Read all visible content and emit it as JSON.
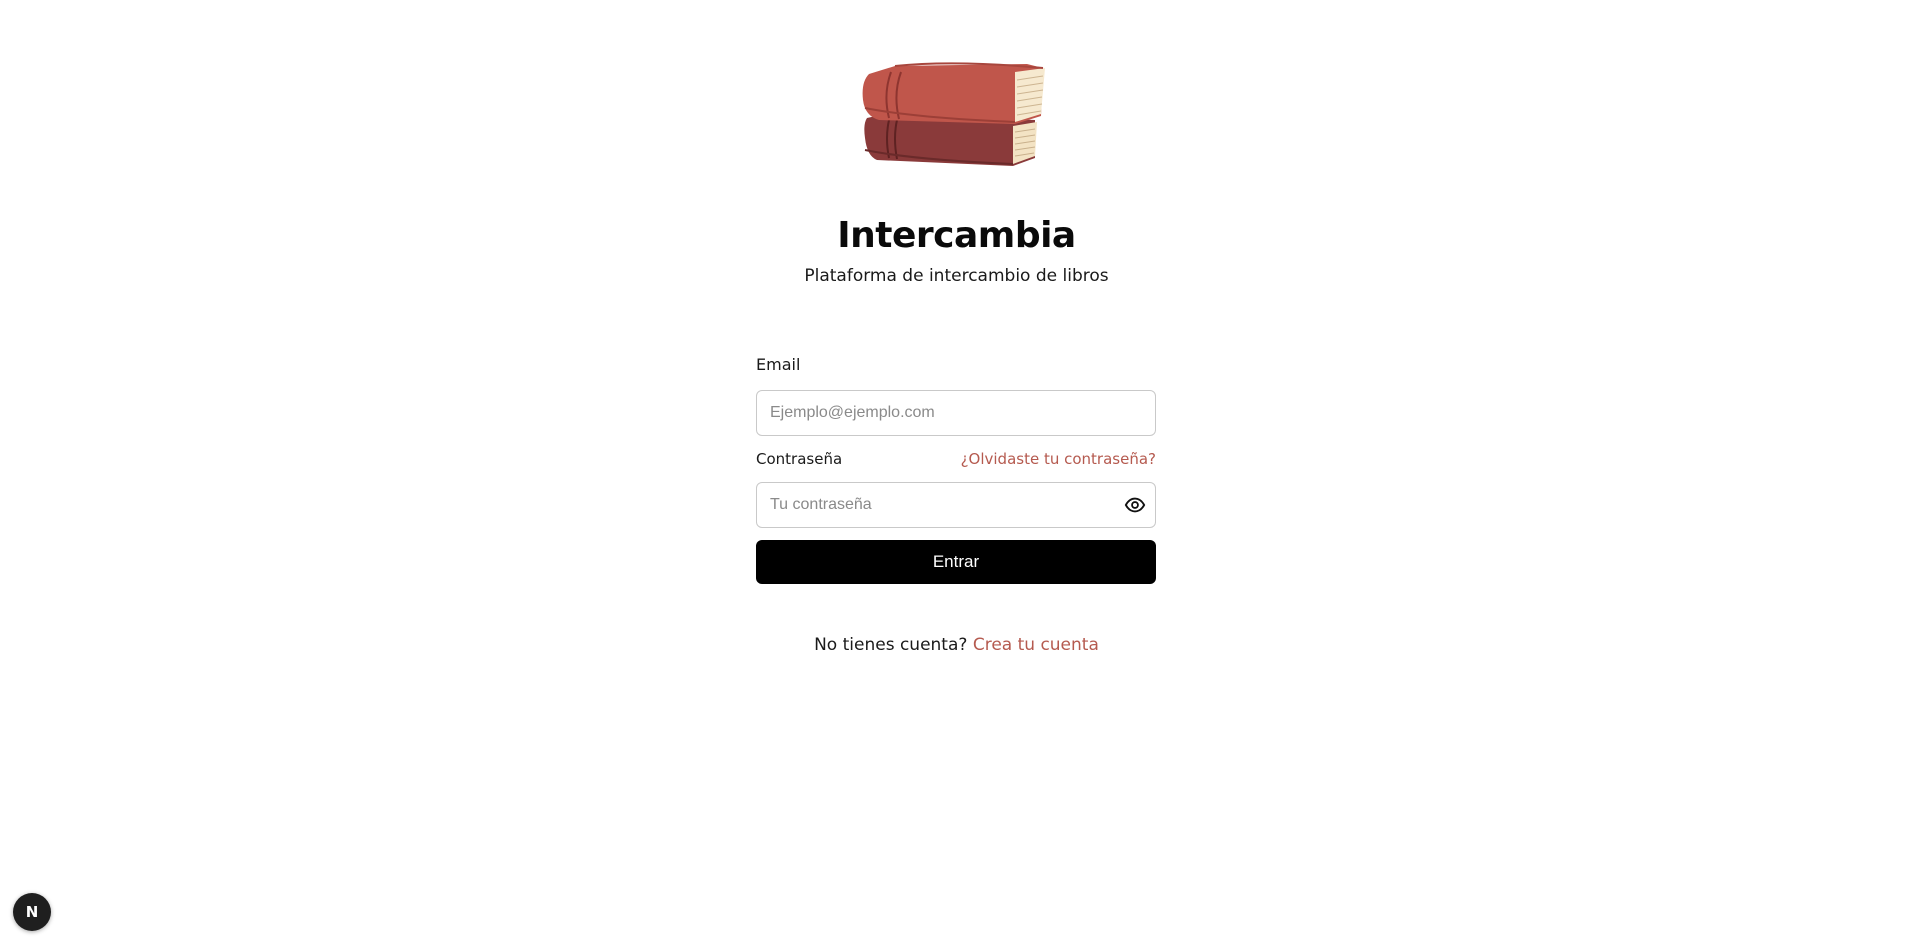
{
  "app": {
    "title": "Intercambia",
    "subtitle": "Plataforma de intercambio de libros",
    "logo_icon": "stacked-books-icon",
    "accent_color": "#b55a4f"
  },
  "form": {
    "email_label": "Email",
    "email_placeholder": "Ejemplo@ejemplo.com",
    "email_value": "",
    "password_label": "Contraseña",
    "forgot_password": "¿Olvidaste tu contraseña?",
    "password_placeholder": "Tu contraseña",
    "password_value": "",
    "password_toggle_icon": "eye-icon",
    "submit_label": "Entrar"
  },
  "signup": {
    "prompt": "No tienes cuenta?",
    "link": "Crea tu cuenta"
  },
  "dev_badge": {
    "letter": "N"
  }
}
